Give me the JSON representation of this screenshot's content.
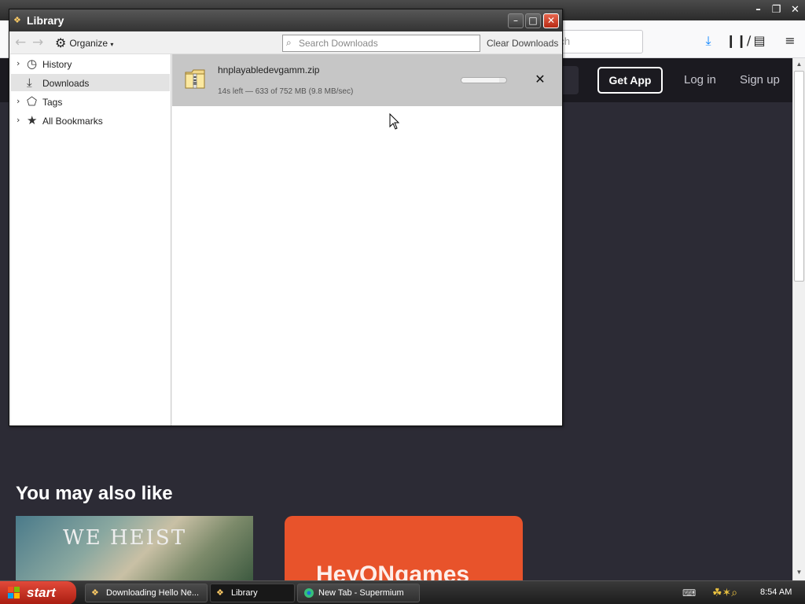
{
  "background_browser": {
    "url_fragment": "rch",
    "header": {
      "get_app": "Get App",
      "log_in": "Log in",
      "sign_up": "Sign up"
    },
    "section_title": "You may also like",
    "cards": [
      {
        "title": "WE HEIST"
      },
      {
        "title": "HeyONgames"
      }
    ]
  },
  "library": {
    "title": "Library",
    "toolbar": {
      "organize": "Organize",
      "search_placeholder": "Search Downloads",
      "clear_downloads": "Clear Downloads"
    },
    "sidebar": [
      {
        "label": "History",
        "icon": "clock-icon",
        "expandable": true
      },
      {
        "label": "Downloads",
        "icon": "download-icon",
        "expandable": false,
        "selected": true
      },
      {
        "label": "Tags",
        "icon": "tag-icon",
        "expandable": true
      },
      {
        "label": "All Bookmarks",
        "icon": "star-icon",
        "expandable": true
      }
    ],
    "download": {
      "filename": "hnplayabledevgamm.zip",
      "status": "14s left — 633 of 752 MB (9.8 MB/sec)",
      "progress": 0.84
    }
  },
  "taskbar": {
    "start": "start",
    "tasks": [
      {
        "label": "Downloading Hello Ne...",
        "active": false
      },
      {
        "label": "Library",
        "active": true
      },
      {
        "label": "New Tab - Supermium",
        "active": false
      }
    ],
    "clock": "8:54 AM"
  },
  "colors": {
    "page_bg": "#2c2b35",
    "site_header": "#1b1a20",
    "card_orange": "#e8532b",
    "start_red": "#c8321f",
    "download_row": "#c6c6c6"
  }
}
